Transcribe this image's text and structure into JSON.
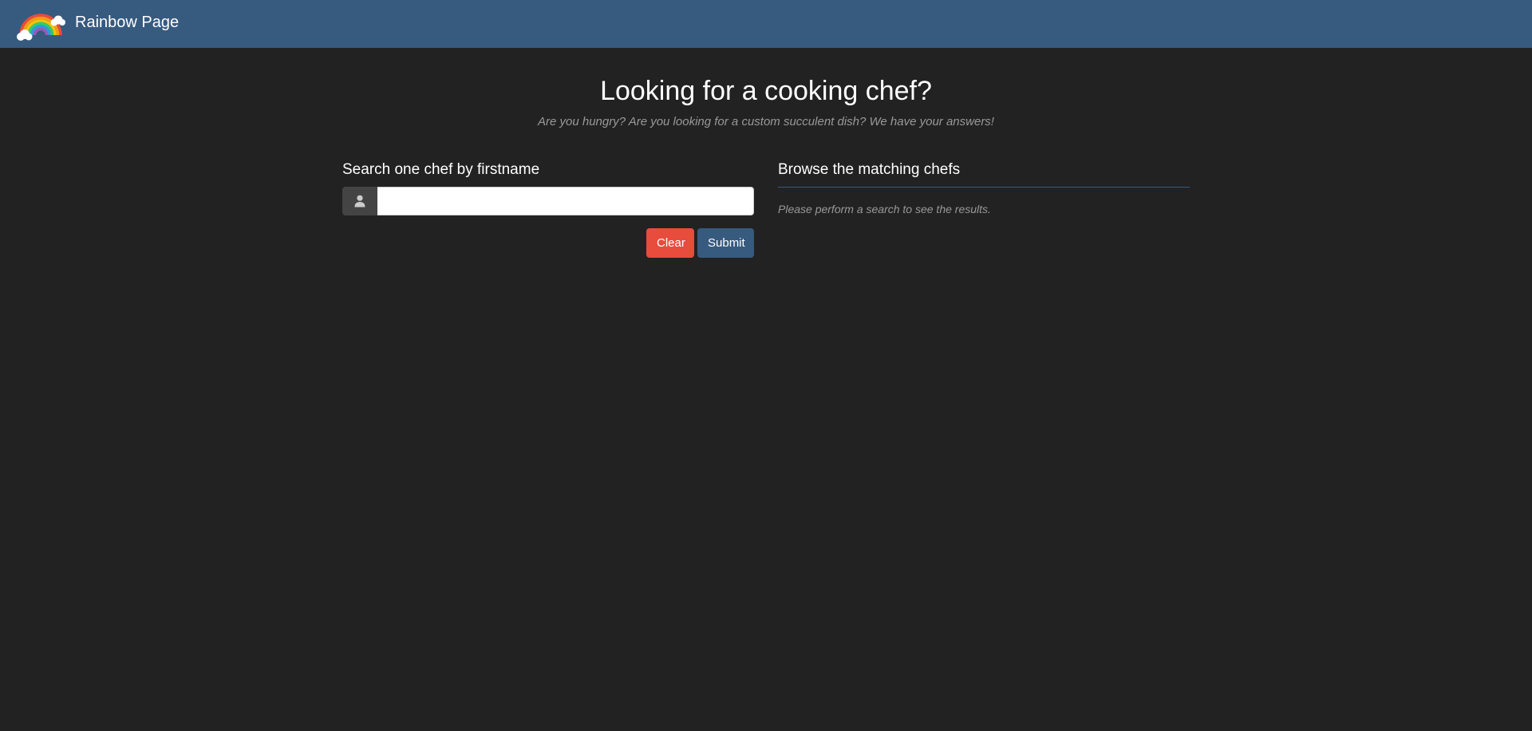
{
  "navbar": {
    "brand_name": "Rainbow Page",
    "logo_icon": "rainbow-icon",
    "background_color": "#375a7f"
  },
  "header": {
    "title": "Looking for a cooking chef?",
    "subtitle": "Are you hungry? Are you looking for a custom succulent dish? We have your answers!"
  },
  "search": {
    "heading": "Search one chef by firstname",
    "input_icon": "user-icon",
    "input_value": "",
    "input_placeholder": "",
    "clear_label": "Clear",
    "submit_label": "Submit",
    "clear_color": "#e74c3c",
    "submit_color": "#375a7f"
  },
  "results": {
    "heading": "Browse the matching chefs",
    "empty_message": "Please perform a search to see the results."
  }
}
